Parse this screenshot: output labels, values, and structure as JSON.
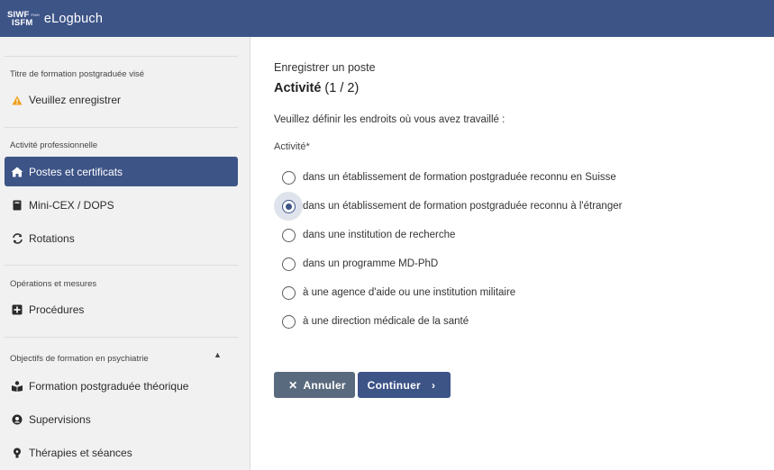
{
  "header": {
    "logo_line1": "SIWF",
    "logo_fmh": "FMH",
    "logo_line2": "ISFM",
    "app_title": "eLogbuch"
  },
  "sidebar": {
    "section1_title": "Titre de formation postgraduée visé",
    "warning_label": "Veuillez enregistrer",
    "section2_title": "Activité professionnelle",
    "items_pro": [
      {
        "label": "Postes et certificats",
        "icon": "house-icon",
        "active": true
      },
      {
        "label": "Mini-CEX / DOPS",
        "icon": "book-icon",
        "active": false
      },
      {
        "label": "Rotations",
        "icon": "rotate-icon",
        "active": false
      }
    ],
    "section3_title": "Opérations et mesures",
    "items_ops": [
      {
        "label": "Procédures",
        "icon": "plus-square-icon"
      }
    ],
    "section4_title": "Objectifs de formation en psychiatrie",
    "items_psy": [
      {
        "label": "Formation postgraduée théorique",
        "icon": "reading-icon"
      },
      {
        "label": "Supervisions",
        "icon": "supervision-icon"
      },
      {
        "label": "Thérapies et séances",
        "icon": "therapy-icon"
      }
    ]
  },
  "main": {
    "subtitle": "Enregistrer un poste",
    "heading_bold": "Activité",
    "heading_step": "(1 / 2)",
    "instruction": "Veuillez définir les endroits où vous avez travaillé :",
    "field_label": "Activité*",
    "options": [
      {
        "label": "dans un établissement de formation postgraduée reconnu en Suisse",
        "selected": false
      },
      {
        "label": "dans un établissement de formation postgraduée reconnu à l'étranger",
        "selected": true
      },
      {
        "label": "dans une institution de recherche",
        "selected": false
      },
      {
        "label": "dans un programme MD-PhD",
        "selected": false
      },
      {
        "label": "à une agence d'aide ou une institution militaire",
        "selected": false
      },
      {
        "label": "à une direction médicale de la santé",
        "selected": false
      }
    ],
    "cancel_label": "Annuler",
    "continue_label": "Continuer"
  },
  "colors": {
    "brand": "#3d5487",
    "cancel": "#5a6a7e",
    "warning": "#f0a020"
  }
}
